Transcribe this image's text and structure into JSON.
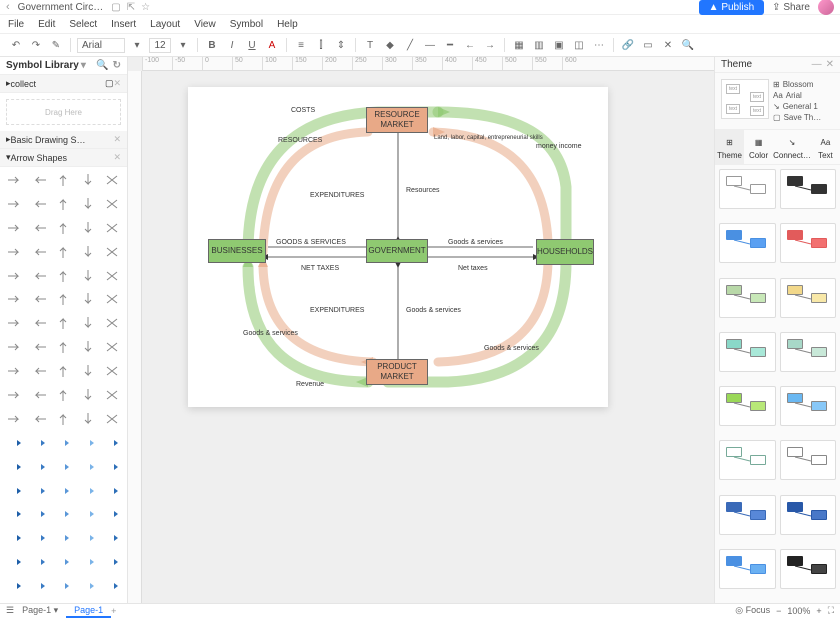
{
  "title": {
    "doc": "Government Circ…"
  },
  "menus": [
    "File",
    "Edit",
    "Select",
    "Insert",
    "Layout",
    "View",
    "Symbol",
    "Help"
  ],
  "buttons": {
    "publish": "Publish",
    "share": "Share"
  },
  "toolbar": {
    "font": "Arial",
    "size": "12"
  },
  "left": {
    "header": "Symbol Library",
    "collect": "collect",
    "drag": "Drag Here",
    "basic": "Basic Drawing S…",
    "arrow": "Arrow Shapes"
  },
  "right": {
    "header": "Theme",
    "opts": [
      "Blossom",
      "Arial",
      "General 1",
      "Save Th…"
    ],
    "tabs": [
      "Theme",
      "Color",
      "Connect…",
      "Text"
    ]
  },
  "status": {
    "page": "Page-1",
    "focus": "Focus",
    "zoom": "100%"
  },
  "diagram": {
    "nodes": {
      "resource_market": "RESOURCE MARKET",
      "businesses": "BUSINESSES",
      "government": "GOVERNMENT",
      "households": "HOUSEHOLDS",
      "product_market": "PRODUCT MARKET"
    },
    "labels": {
      "costs": "COSTS",
      "resources_upper": "RESOURCES",
      "land_labor": "Land, labor, capital, entrepreneurial skills",
      "money_income": "money income",
      "expenditures1": "EXPENDITURES",
      "resources_lower": "Resources",
      "goods_services_upper": "GOODS & SERVICES",
      "gs_right_upper": "Goods & services",
      "net_taxes_upper": "NET TAXES",
      "net_taxes_lower": "Net taxes",
      "expenditures2": "EXPENDITURES",
      "gs_mid": "Goods & services",
      "gs_left_lower": "Goods & services",
      "gs_right_lower": "Goods & services",
      "revenue": "Revenue"
    }
  },
  "ruler_marks": [
    "-100",
    "-50",
    "0",
    "50",
    "100",
    "150",
    "200",
    "250",
    "300",
    "350",
    "400",
    "450",
    "500",
    "550",
    "600"
  ]
}
